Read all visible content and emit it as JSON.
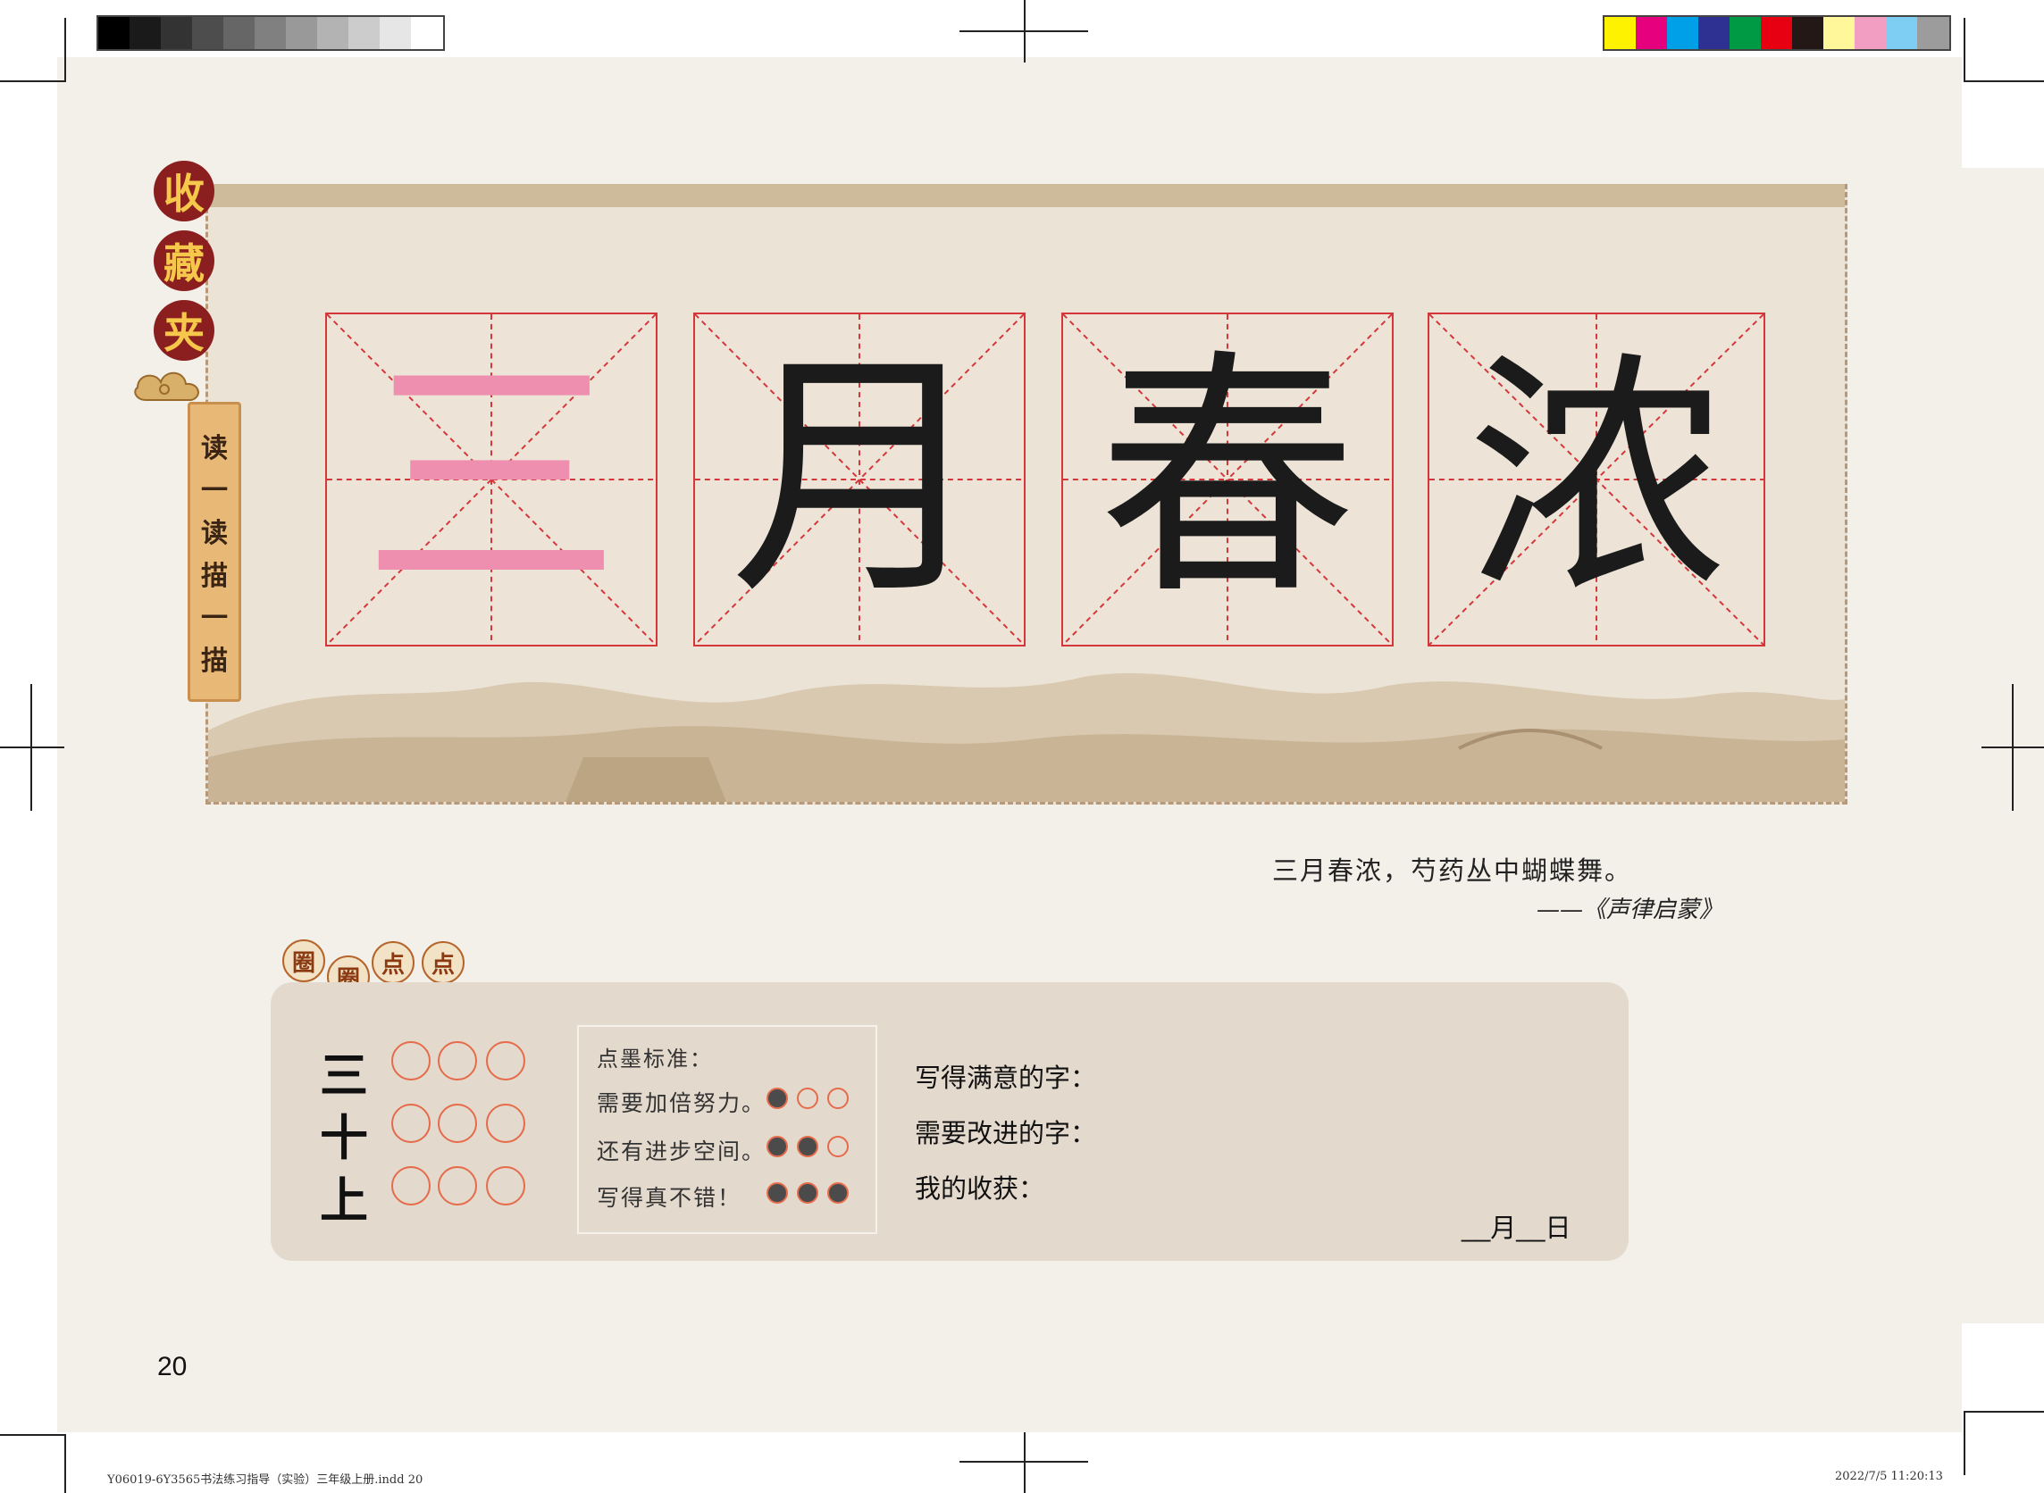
{
  "side_seals": [
    "收",
    "藏",
    "夹"
  ],
  "side_scroll_label": [
    "读",
    "一",
    "读",
    "描",
    "一",
    "描"
  ],
  "characters": [
    {
      "char": "三",
      "tone": "pink"
    },
    {
      "char": "月",
      "tone": "black"
    },
    {
      "char": "春",
      "tone": "black"
    },
    {
      "char": "浓",
      "tone": "black"
    }
  ],
  "quote": {
    "line": "三月春浓，芍药丛中蝴蝶舞。",
    "source": "——《声律启蒙》"
  },
  "section_badges": [
    "圈",
    "圈",
    "点",
    "点"
  ],
  "practice_chars": [
    "三",
    "十",
    "上"
  ],
  "criteria": {
    "title": "点墨标准：",
    "items": [
      {
        "text": "需要加倍努力。",
        "filled": 1
      },
      {
        "text": "还有进步空间。",
        "filled": 2
      },
      {
        "text": "写得真不错！",
        "filled": 3
      }
    ]
  },
  "fields": {
    "satisfied": "写得满意的字：",
    "improve": "需要改进的字：",
    "gain": "我的收获："
  },
  "date_label": "__月__日",
  "page_number": "20",
  "footer": {
    "file": "Y06019-6Y3565书法练习指导（实验）三年级上册.indd   20",
    "timestamp": "2022/7/5   11:20:13"
  },
  "colors": {
    "grid_red": "#d4363a",
    "trace_pink": "#ef8fb0",
    "seal_red": "#8b1f1f",
    "ring_orange": "#e56b4b"
  }
}
